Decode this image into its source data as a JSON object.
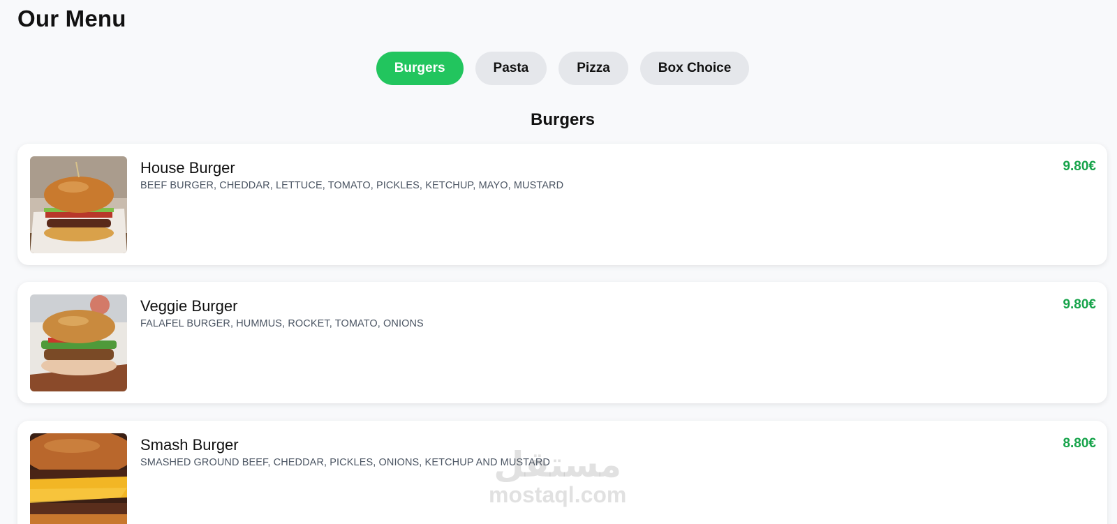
{
  "page": {
    "title": "Our Menu"
  },
  "tabs": [
    {
      "label": "Burgers",
      "active": true
    },
    {
      "label": "Pasta",
      "active": false
    },
    {
      "label": "Pizza",
      "active": false
    },
    {
      "label": "Box Choice",
      "active": false
    }
  ],
  "section": {
    "title": "Burgers"
  },
  "items": [
    {
      "name": "House Burger",
      "description": "BEEF BURGER, CHEDDAR, LETTUCE, TOMATO, PICKLES, KETCHUP, MAYO, MUSTARD",
      "price": "9.80€",
      "image": "house-burger-photo"
    },
    {
      "name": "Veggie Burger",
      "description": "FALAFEL BURGER, HUMMUS, ROCKET, TOMATO, ONIONS",
      "price": "9.80€",
      "image": "veggie-burger-photo"
    },
    {
      "name": "Smash Burger",
      "description": "SMASHED GROUND BEEF, CHEDDAR, PICKLES, ONIONS, KETCHUP AND MUSTARD",
      "price": "8.80€",
      "image": "smash-burger-photo"
    }
  ],
  "watermark": {
    "logo": "مستقل",
    "url": "mostaql.com"
  },
  "colors": {
    "accent": "#22c55e",
    "price": "#16a34a",
    "tab_inactive": "#e5e7eb",
    "background": "#f8f9fb"
  }
}
